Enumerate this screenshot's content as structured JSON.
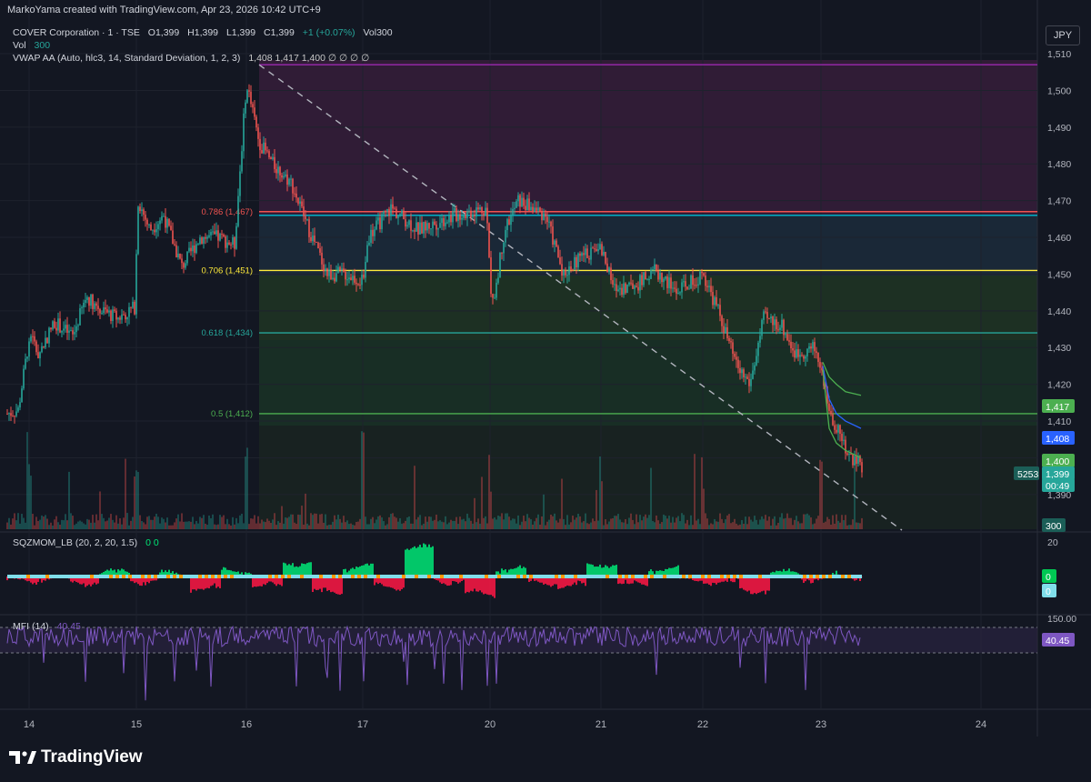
{
  "header": {
    "watermark": "MarkoYama created with TradingView.com, Apr 23, 2026 10:42 UTC+9",
    "symbol": "COVER Corporation · 1 · TSE",
    "o": "O1,399",
    "h": "H1,399",
    "l": "L1,399",
    "c": "C1,399",
    "chg": "+1 (+0.07%)",
    "vol": "Vol300",
    "vol_label": "Vol",
    "vol_value": "300",
    "vwap_label": "VWAP AA (Auto, hlc3, 14, Standard Deviation, 1, 2, 3)",
    "vwap_values": "1,408   1,417   1,400   ∅  ∅  ∅  ∅",
    "currency": "JPY"
  },
  "colors": {
    "bg": "#131722",
    "up": "#26a69a",
    "down": "#ef5350",
    "fib_1": "#9c27b0",
    "fib_0786": "#ef5350",
    "fib_0786b": "#00bcd4",
    "fib_0706": "#ffeb3b",
    "fib_0618": "#26a69a",
    "fib_05": "#4caf50",
    "vwap": "#2962ff",
    "vwap_upper": "#4caf50",
    "mfi": "#7e57c2"
  },
  "fib_labels": {
    "f0786": "0.786 (1,467)",
    "f0706": "0.706 (1,451)",
    "f0618": "0.618 (1,434)",
    "f05": "0.5 (1,412)"
  },
  "price_axis": {
    "ticks": [
      "1,510",
      "1,500",
      "1,490",
      "1,480",
      "1,470",
      "1,460",
      "1,450",
      "1,440",
      "1,430",
      "1,420",
      "1,410",
      "1,400",
      "1,390"
    ],
    "tick_values": [
      1510,
      1500,
      1490,
      1480,
      1470,
      1460,
      1450,
      1440,
      1430,
      1420,
      1410,
      1400,
      1390
    ],
    "tags": [
      {
        "text": "1,417",
        "value": 1417,
        "color": "#4caf50"
      },
      {
        "text": "1,408",
        "value": 1408,
        "color": "#2962ff"
      },
      {
        "text": "1,400",
        "value": 1400,
        "color": "#4caf50"
      },
      {
        "text": "1,399",
        "value": 1399,
        "color": "#26a69a"
      },
      {
        "text": "00:49",
        "value": 1396,
        "color": "#26a69a"
      }
    ],
    "vol_tag": "5253",
    "vol_axis_tag": "300"
  },
  "time_axis": [
    "14",
    "15",
    "16",
    "17",
    "20",
    "21",
    "22",
    "23",
    "24"
  ],
  "sqz": {
    "label": "SQZMOM_LB (20, 2, 20, 1.5)",
    "values": "0   0",
    "axis_top": "20",
    "tag_green": "0",
    "tag_blue": "0"
  },
  "mfi": {
    "label": "MFI (14)",
    "value": "40.45",
    "axis_top": "150.00",
    "tag": "40.45"
  },
  "branding": "TradingView",
  "chart_data": [
    {
      "type": "line",
      "title": "COVER Corporation · 1 · TSE",
      "series": [
        {
          "name": "price",
          "x": [
            "14",
            "14",
            "14",
            "15",
            "15",
            "15",
            "16",
            "16",
            "16",
            "17",
            "17",
            "17",
            "20",
            "20",
            "20",
            "21",
            "21",
            "21",
            "22",
            "22",
            "22",
            "23",
            "23",
            "23"
          ],
          "y": [
            1412,
            1435,
            1438,
            1448,
            1466,
            1460,
            1452,
            1500,
            1478,
            1452,
            1462,
            1466,
            1468,
            1442,
            1470,
            1460,
            1455,
            1447,
            1452,
            1437,
            1418,
            1430,
            1410,
            1399
          ]
        },
        {
          "name": "Vol",
          "values": [
            300
          ]
        }
      ],
      "fib_levels": [
        {
          "ratio": "1",
          "price": 1507
        },
        {
          "ratio": "0.786",
          "price": 1467
        },
        {
          "ratio": "0.706",
          "price": 1451
        },
        {
          "ratio": "0.618",
          "price": 1434
        },
        {
          "ratio": "0.5",
          "price": 1412
        }
      ],
      "vwap": [
        1417,
        1408,
        1400
      ],
      "ylim": [
        1385,
        1512
      ],
      "grid": true
    },
    {
      "type": "area",
      "title": "SQZMOM_LB (20, 2, 20, 1.5)",
      "ylim": [
        -20,
        20
      ],
      "values": [
        -2,
        -1,
        -3,
        2,
        -2,
        1,
        -6,
        3,
        -5,
        7,
        -8,
        5,
        -5,
        14,
        -2,
        -9,
        4,
        -3,
        -5,
        6,
        -4,
        4,
        -2,
        -3,
        -7,
        2,
        -1,
        0
      ]
    },
    {
      "type": "line",
      "title": "MFI (14)",
      "ylim": [
        0,
        150
      ],
      "last": 40.45
    }
  ]
}
